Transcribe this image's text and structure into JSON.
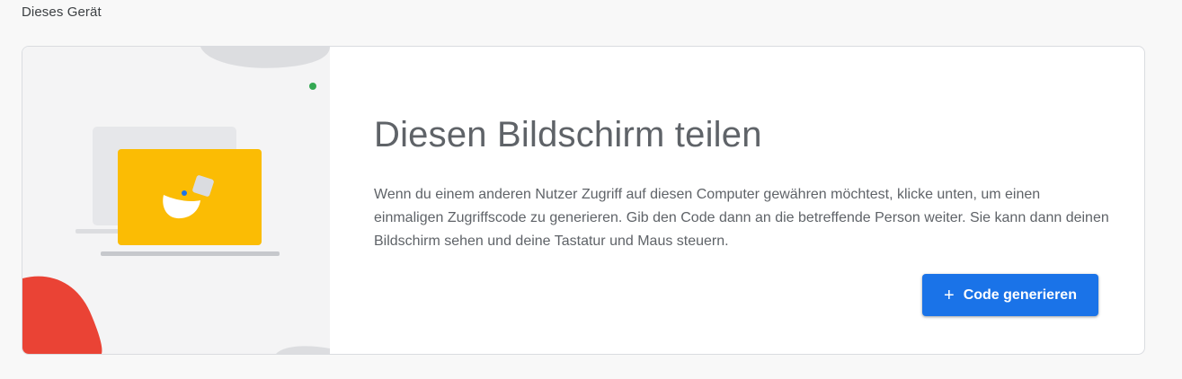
{
  "section": {
    "title": "Dieses Gerät"
  },
  "card": {
    "heading": "Diesen Bildschirm teilen",
    "description": "Wenn du einem anderen Nutzer Zugriff auf diesen Computer gewähren möchtest, klicke unten, um einen einmaligen Zugriffscode zu generieren. Gib den Code dann an die betreffende Person weiter. Sie kann dann deinen Bildschirm sehen und deine Tastatur und Maus steuern.",
    "button": {
      "label": "Code generieren",
      "icon": "plus-icon",
      "glyph": "+"
    }
  },
  "colors": {
    "accent": "#1a73e8",
    "illustration_yellow": "#fbbc04",
    "illustration_red": "#ea4335",
    "illustration_green": "#34a853"
  }
}
